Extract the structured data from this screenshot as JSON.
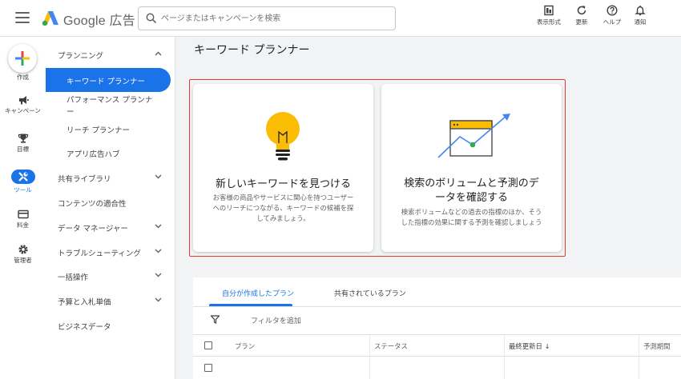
{
  "app": {
    "brand": "Google 広告",
    "search_placeholder": "ページまたはキャンペーンを検索"
  },
  "top_actions": [
    {
      "label": "表示形式",
      "icon": "display-format-icon"
    },
    {
      "label": "更新",
      "icon": "refresh-icon"
    },
    {
      "label": "ヘルプ",
      "icon": "help-icon"
    },
    {
      "label": "通知",
      "icon": "bell-icon"
    }
  ],
  "rail": {
    "create_label": "作成",
    "campaign_label": "キャンペーン",
    "goals_label": "目標",
    "tools_label": "ツール",
    "billing_label": "料金",
    "admin_label": "管理者"
  },
  "nav": {
    "planning": "プランニング",
    "keyword_planner": "キーワード プランナー",
    "performance_planner": "パフォーマンス プランナ",
    "performance_planner_wrap": "ー",
    "reach_planner": "リーチ プランナー",
    "app_ads_hub": "アプリ広告ハブ",
    "shared_library": "共有ライブラリ",
    "content_suitability": "コンテンツの適合性",
    "data_manager": "データ マネージャー",
    "troubleshooting": "トラブルシューティング",
    "bulk_actions": "一括操作",
    "budget_and_bidding": "予算と入札単価",
    "business_data": "ビジネスデータ"
  },
  "main": {
    "title": "キーワード プランナー",
    "card_discover": {
      "heading": "新しいキーワードを見つける",
      "desc1": "お客様の商品やサービスに関心を持つユーザー",
      "desc2": "へのリーチにつながる、キーワードの候補を探",
      "desc3": "してみましょう。"
    },
    "card_forecast": {
      "heading1": "検索のボリュームと予測のデ",
      "heading2": "ータを確認する",
      "desc1": "検索ボリュームなどの過去の指標のほか、そう",
      "desc2": "した指標の効果に関する予測を確認しましょう"
    }
  },
  "plans": {
    "tab_mine": "自分が作成したプラン",
    "tab_shared": "共有されているプラン",
    "filter_label": "フィルタを追加",
    "columns": {
      "plan": "プラン",
      "status": "ステータス",
      "last_updated": "最終更新日",
      "forecast_period": "予測期間"
    },
    "sort_indicator": "↓"
  },
  "colors": {
    "accent": "#1a73e8",
    "highlight": "#e53935",
    "bulb": "#fbbc04",
    "chart_green": "#34a853"
  }
}
